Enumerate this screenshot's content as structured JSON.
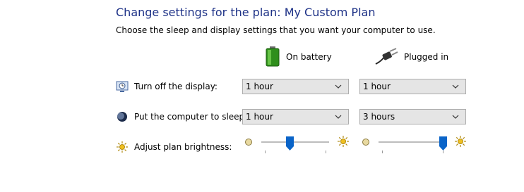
{
  "header": {
    "title": "Change settings for the plan: My Custom Plan",
    "subtitle": "Choose the sleep and display settings that you want your computer to use."
  },
  "columns": {
    "battery": {
      "label": "On battery",
      "icon": "battery-icon"
    },
    "plugged": {
      "label": "Plugged in",
      "icon": "power-plug-icon"
    }
  },
  "rows": {
    "display": {
      "label": "Turn off the display:",
      "icon": "display-clock-icon",
      "battery_value": "1 hour",
      "plugged_value": "1 hour"
    },
    "sleep": {
      "label": "Put the computer to sleep:",
      "icon": "sleep-moon-icon",
      "battery_value": "1 hour",
      "plugged_value": "3 hours"
    },
    "brightness": {
      "label": "Adjust plan brightness:",
      "icon": "brightness-sun-icon",
      "battery_level": 0.42,
      "plugged_level": 0.95
    }
  },
  "colors": {
    "title": "#1e3287",
    "slider_thumb": "#0a64c8",
    "select_bg": "#e5e5e5"
  }
}
